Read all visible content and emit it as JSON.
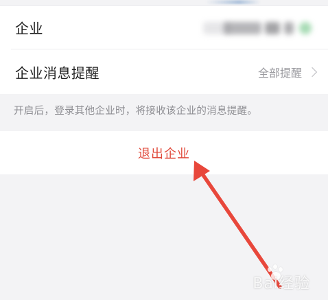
{
  "settings": {
    "enterprise_label": "企业",
    "notify_label": "企业消息提醒",
    "notify_value": "全部提醒",
    "hint": "开启后，登录其他企业时，将接收该企业的消息提醒。"
  },
  "actions": {
    "exit_label": "退出企业"
  },
  "watermark": {
    "text": "Bai经验"
  },
  "colors": {
    "exit": "#e0493a",
    "annotation_arrow": "#e8473b"
  }
}
